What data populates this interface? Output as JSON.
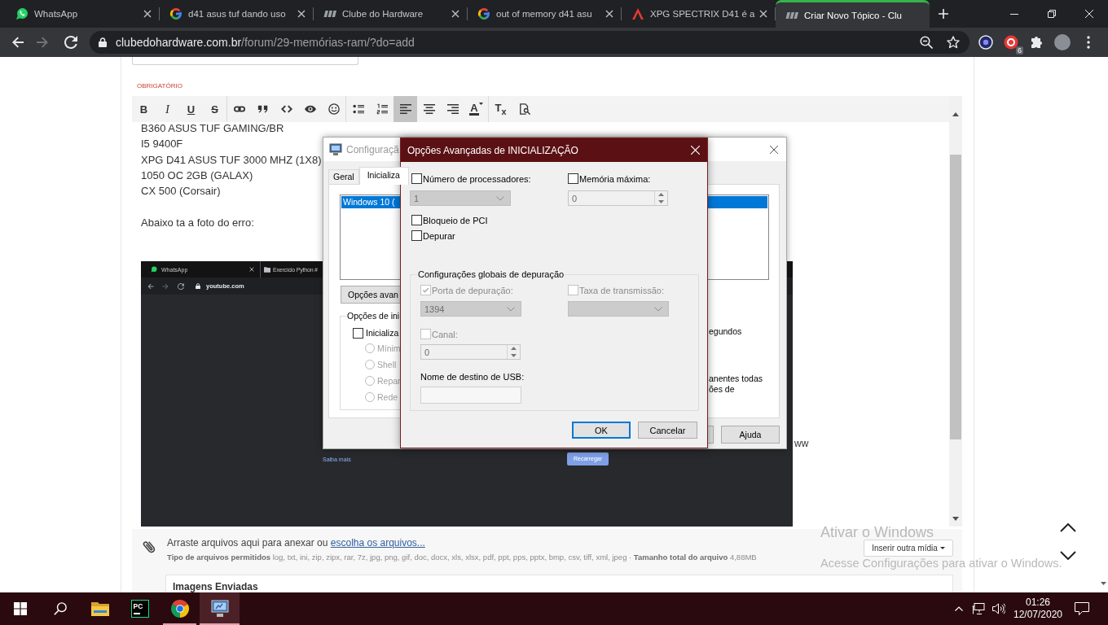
{
  "browser": {
    "tabs": [
      {
        "title": "WhatsApp",
        "kind": "chat",
        "selected": false
      },
      {
        "title": "d41 asus tuf dando uso",
        "kind": "ring",
        "selected": false
      },
      {
        "title": "Clube do Hardware",
        "kind": "logo",
        "selected": false
      },
      {
        "title": "out of memory d41 asu",
        "kind": "ring",
        "selected": false
      },
      {
        "title": "XPG SPECTRIX D41 é a",
        "kind": "triangle",
        "selected": false
      },
      {
        "title": "Criar Novo Tópico - Clu",
        "kind": "logo",
        "selected": true
      }
    ],
    "url": {
      "domain": "clubedohardware.com.br",
      "path": "/forum/29-memórias-ram/?do=add"
    },
    "extension_badge": "6"
  },
  "post_form": {
    "required_label": "OBRIGATÓRIO",
    "toolbar": [
      [
        {
          "kind": "bold",
          "label": "B",
          "selected": false
        },
        {
          "kind": "italic",
          "label": "I",
          "selected": false
        },
        {
          "kind": "underline",
          "label": "U",
          "selected": false
        },
        {
          "kind": "strike",
          "label": "S",
          "selected": false
        }
      ],
      [
        {
          "kind": "link",
          "selected": false
        },
        {
          "kind": "quote",
          "selected": false
        },
        {
          "kind": "code",
          "selected": false
        },
        {
          "kind": "spoiler",
          "selected": false
        },
        {
          "kind": "emoji",
          "selected": false
        }
      ],
      [
        {
          "kind": "bullets",
          "selected": false
        },
        {
          "kind": "numbers",
          "selected": false
        },
        {
          "kind": "left",
          "selected": true
        },
        {
          "kind": "center",
          "selected": false
        },
        {
          "kind": "right",
          "selected": false
        },
        {
          "kind": "color",
          "label": "A",
          "selected": false
        }
      ],
      [
        {
          "kind": "clear",
          "label": "T$_{x}$",
          "selected": false
        },
        {
          "kind": "preview",
          "selected": false
        }
      ]
    ],
    "paragraphs": [
      [
        "B360 ASUS TUF GAMING/BR",
        "I5 9400F",
        "XPG D41 ASUS TUF 3000 MHZ (1X8)",
        "1050 OC 2GB (GALAX)",
        "CX 500 (Corsair)"
      ],
      [
        "Abaixo ta a foto do erro:"
      ]
    ],
    "embedded_screenshot": {
      "tabs": [
        "WhatsApp",
        "Exercício Python #"
      ],
      "url": "youtube.com",
      "link": "Saiba mais",
      "button": "Recarregar"
    },
    "trailing_text": "ww",
    "attachments": {
      "prompt": "Arraste arquivos aqui para anexar ou",
      "link": "escolha os arquivos...",
      "allowed": "**Tipo de arquivos permitidos** log, txt, ini, zip, zipx, rar, 7z, jpg, png, gif, doc, docx, xls, xlsx, pdf, ppt, pps, pptx, bmp, csv, tiff, xml, jpeg · **Tamanho total do arquivo** 4,88MB",
      "insert_button": "Inserir outra mídia",
      "uploaded_title": "Imagens Enviadas"
    }
  },
  "system_config_dialog": {
    "title": "Configuraçã",
    "tabs": [
      {
        "label": "Geral",
        "selected": false
      },
      {
        "label": "Inicializa",
        "selected": true
      }
    ],
    "boot_entries": [
      {
        "label": "Windows 10 (",
        "selected": true
      }
    ],
    "advanced_button": "Opções avan",
    "options_group": {
      "title": "Opções de ini",
      "safe_boot": {
        "label": "Inicializa",
        "checked": false
      },
      "modes": [
        {
          "label": "Mínim",
          "selected": false,
          "disabled": true
        },
        {
          "label": "Shell",
          "selected": false,
          "disabled": true
        },
        {
          "label": "Repar",
          "selected": false,
          "disabled": true
        },
        {
          "label": "Rede",
          "selected": false,
          "disabled": true
        }
      ]
    },
    "timeout_fragment": "egundos",
    "note_fragments": [
      "anentes todas",
      "ões de"
    ],
    "buttons": [
      "Ajuda"
    ]
  },
  "advanced_boot_dialog": {
    "title": "Opções Avançadas de INICIALIZAÇÃO",
    "processors": {
      "label": "Número de processadores:",
      "checked": false,
      "value": "1",
      "disabled": true
    },
    "max_memory": {
      "label": "Memória máxima:",
      "checked": false,
      "value": "0",
      "disabled": true
    },
    "pci_lock": {
      "label": "Bloqueio de PCI",
      "checked": false
    },
    "debug": {
      "label": "Depurar",
      "checked": false
    },
    "debug_settings": {
      "title": "Configurações globais de depuração",
      "port": {
        "label": "Porta de depuração:",
        "checked": true,
        "disabled": true,
        "value": "1394"
      },
      "baud_rate": {
        "label": "Taxa de transmissão:",
        "checked": false,
        "disabled": true
      },
      "channel": {
        "label": "Canal:",
        "checked": false,
        "disabled": true,
        "value": "0"
      },
      "usb_target": {
        "label": "Nome de destino de USB:"
      }
    },
    "buttons": [
      {
        "label": "OK",
        "focused": true
      },
      {
        "label": "Cancelar",
        "focused": false
      }
    ]
  },
  "activation_notice": {
    "title": "Ativar o Windows",
    "text": "Acesse Configurações para ativar o Windows."
  },
  "taskbar": {
    "apps": [
      {
        "kind": "folder",
        "running": false,
        "selected": false
      },
      {
        "kind": "ide",
        "label": "PC",
        "running": false,
        "selected": false
      },
      {
        "kind": "browser",
        "running": true,
        "selected": false
      },
      {
        "kind": "sysconfig",
        "running": true,
        "selected": true
      }
    ],
    "time": "01:26",
    "date": "12/07/2020"
  }
}
